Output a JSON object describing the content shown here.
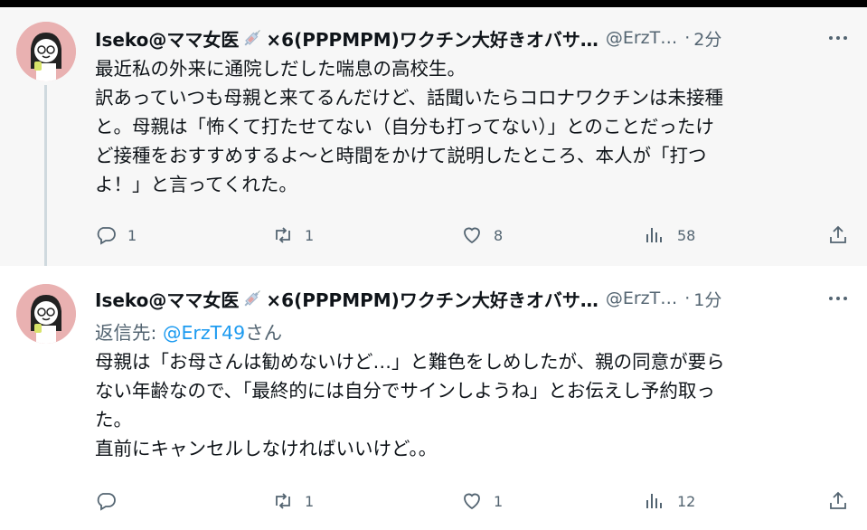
{
  "tweets": [
    {
      "author_name_prefix": "Iseko@ママ女医",
      "author_name_suffix": "×6(PPPMPM)ワクチン大好きオバサ…",
      "handle": "@ErzT…",
      "separator": "·",
      "time": "2分",
      "body_lines": [
        "最近私の外来に通院しだした喘息の高校生。",
        "訳あっていつも母親と来てるんだけど、話聞いたらコロナワクチンは未接種",
        "と。母親は「怖くて打たせてない（自分も打ってない）」とのことだったけ",
        "ど接種をおすすめするよ～と時間をかけて説明したところ、本人が「打つ",
        "よ！」と言ってくれた。"
      ],
      "reply_count": "1",
      "retweet_count": "1",
      "like_count": "8",
      "view_count": "58"
    },
    {
      "author_name_prefix": "Iseko@ママ女医",
      "author_name_suffix": "×6(PPPMPM)ワクチン大好きオバサ…",
      "handle": "@ErzT…",
      "separator": "·",
      "time": "1分",
      "reply_to_prefix": "返信先: ",
      "reply_to_mention": "@ErzT49",
      "reply_to_suffix": "さん",
      "body_lines": [
        "母親は「お母さんは勧めないけど…」と難色をしめしたが、親の同意が要ら",
        "ない年齢なので、「最終的には自分でサインしようね」とお伝えし予約取っ",
        "た。",
        "直前にキャンセルしなければいいけど。。"
      ],
      "reply_count": "",
      "retweet_count": "1",
      "like_count": "1",
      "view_count": "12"
    }
  ],
  "icons": [
    "avatar",
    "syringe-icon",
    "more-icon",
    "reply-icon",
    "retweet-icon",
    "like-icon",
    "views-icon",
    "share-icon"
  ],
  "colors": {
    "secondary_text": "#536471",
    "link": "#1d9bf0",
    "thread_line": "#cfd9de"
  }
}
